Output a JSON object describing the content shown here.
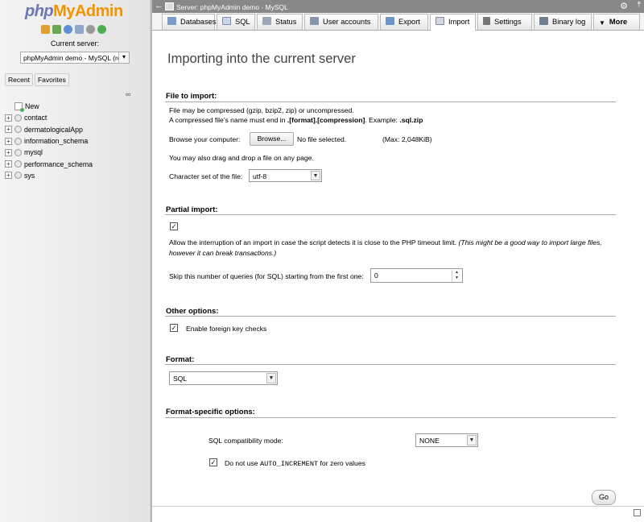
{
  "nav": {
    "logo_php": "php",
    "logo_rest": "MyAdmin",
    "current_server_label": "Current server:",
    "server_select": "phpMyAdmin demo - MySQL (ro",
    "recent_tab": "Recent",
    "favorites_tab": "Favorites",
    "tree": {
      "new": "New",
      "databases": [
        "contact",
        "dermatologicalApp",
        "information_schema",
        "mysql",
        "performance_schema",
        "sys"
      ]
    }
  },
  "topbar": {
    "title": "Server: phpMyAdmin demo - MySQL"
  },
  "tabs": [
    "Databases",
    "SQL",
    "Status",
    "User accounts",
    "Export",
    "Import",
    "Settings",
    "Binary log",
    "More"
  ],
  "active_tab": "Import",
  "page": {
    "title": "Importing into the current server",
    "file_section": {
      "title": "File to import:",
      "line1": "File may be compressed (gzip, bzip2, zip) or uncompressed.",
      "line2_a": "A compressed file's name must end in ",
      "line2_b": ".[format].[compression]",
      "line2_c": ". Example: ",
      "line2_d": ".sql.zip",
      "browse_label": "Browse your computer:",
      "browse_button": "Browse...",
      "no_file": "No file selected.",
      "max": "(Max: 2,048KiB)",
      "drag_text": "You may also drag and drop a file on any page.",
      "charset_label": "Character set of the file:",
      "charset_value": "utf-8"
    },
    "partial_section": {
      "title": "Partial import:",
      "allow_checked": true,
      "allow_text": "Allow the interruption of an import in case the script detects it is close to the PHP timeout limit. ",
      "allow_note_1": "(This might be a good way to import large files,",
      "allow_note_2": "however it can break transactions.)",
      "skip_label": "Skip this number of queries (for SQL) starting from the first one:",
      "skip_value": "0"
    },
    "other_section": {
      "title": "Other options:",
      "fk_checked": true,
      "fk_label": "Enable foreign key checks"
    },
    "format_section": {
      "title": "Format:",
      "format_value": "SQL"
    },
    "specific_section": {
      "title": "Format-specific options:",
      "compat_label": "SQL compatibility mode:",
      "compat_value": "NONE",
      "autoinc_checked": true,
      "autoinc_a": "Do not use ",
      "autoinc_code": "AUTO_INCREMENT",
      "autoinc_b": " for zero values"
    },
    "go_button": "Go"
  },
  "colors": {
    "logo_php": "#6c78af",
    "logo_admin": "#f29400",
    "topbar": "#888888"
  }
}
